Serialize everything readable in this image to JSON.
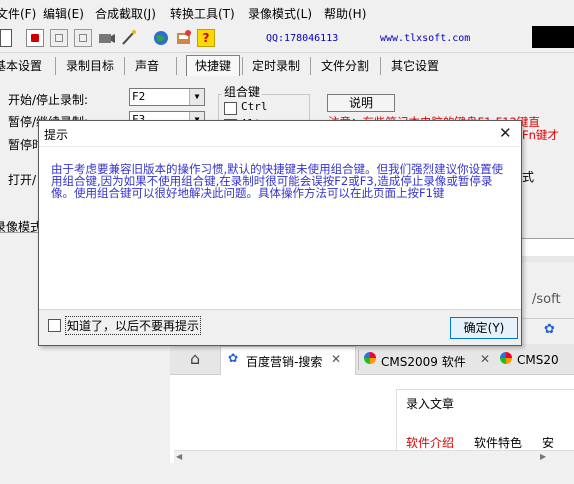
{
  "menu": [
    "文件(F)",
    "编辑(E)",
    "合成截取(J)",
    "转换工具(T)",
    "录像模式(L)",
    "帮助(H)"
  ],
  "toolbar": {
    "qq": "QQ:178046113",
    "site": "www.tlxsoft.com"
  },
  "tabs": [
    "基本设置",
    "录制目标",
    "声音",
    "快捷键",
    "定时录制",
    "文件分割",
    "其它设置"
  ],
  "settings": {
    "start_stop_label": "开始/停止录制:",
    "start_stop_value": "F2",
    "pause_label": "暂停/继续录制:",
    "pause_value": "F3",
    "pause2_label": "暂停时",
    "open_label": "打开/",
    "group_title": "组合键",
    "ctrl_label": "Ctrl",
    "alt_label": "Alt",
    "explain_button": "说明",
    "note_line1": "注意：有些笔记本电脑的键盘F1-F12键直",
    "note_line2": "Fn键才",
    "side_text": "式",
    "record_mode_label": "录像模式"
  },
  "browser": {
    "address": "/soft",
    "tabs": [
      "百度营销-搜索",
      "CMS2009 软件",
      "CMS20"
    ],
    "section_title": "录入文章",
    "content_tabs": [
      "软件介绍",
      "软件特色",
      "安"
    ]
  },
  "dialog": {
    "title": "提示",
    "message": "由于考虑要兼容旧版本的操作习惯,默认的快捷键未使用组合键。但我们强烈建议你设置使用组合键,因为如果不使用组合键,在录制时很可能会误按F2或F3,造成停止录像或暂停录像。使用组合键可以很好地解决此问题。具体操作方法可以在此页面上按F1键",
    "checkbox_label": "知道了，以后不要再提示",
    "ok_button": "确定(Y)"
  },
  "colors": {
    "link": "#0000c0",
    "note": "#e00000",
    "message": "#3333cc",
    "accent": "#0078d7"
  }
}
